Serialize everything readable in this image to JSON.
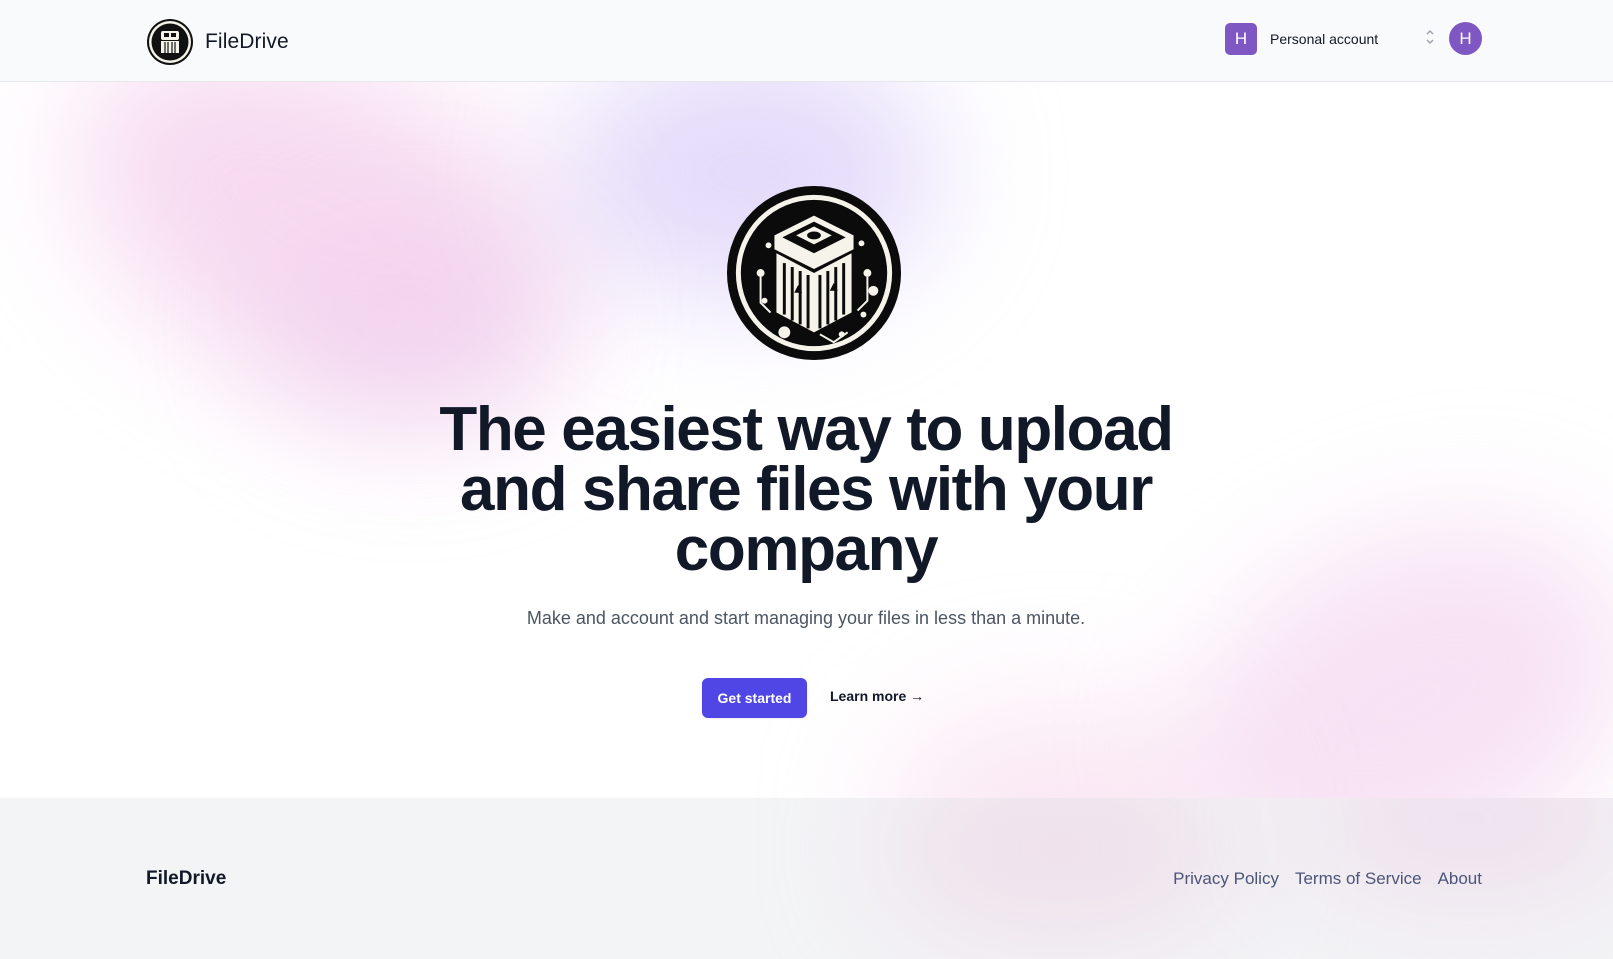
{
  "header": {
    "brand_name": "FileDrive",
    "account_switcher": {
      "avatar_initial": "H",
      "label": "Personal account"
    },
    "user_avatar_initial": "H"
  },
  "hero": {
    "headline": "The easiest way to upload and share files with your company",
    "subheadline": "Make and account and start managing your files in less than a minute.",
    "primary_cta": "Get started",
    "secondary_cta": "Learn more →"
  },
  "footer": {
    "brand_name": "FileDrive",
    "links": [
      "Privacy Policy",
      "Terms of Service",
      "About"
    ]
  },
  "icons": {
    "logo": "circuit-file-logo-icon",
    "chevron": "chevron-up-down-icon"
  },
  "colors": {
    "accent": "#4f46e5",
    "avatar": "#7e57c2",
    "text_dark": "#111827",
    "text_muted": "#4b5563",
    "footer_bg": "#f3f4f6",
    "header_bg": "#f9fafb"
  }
}
